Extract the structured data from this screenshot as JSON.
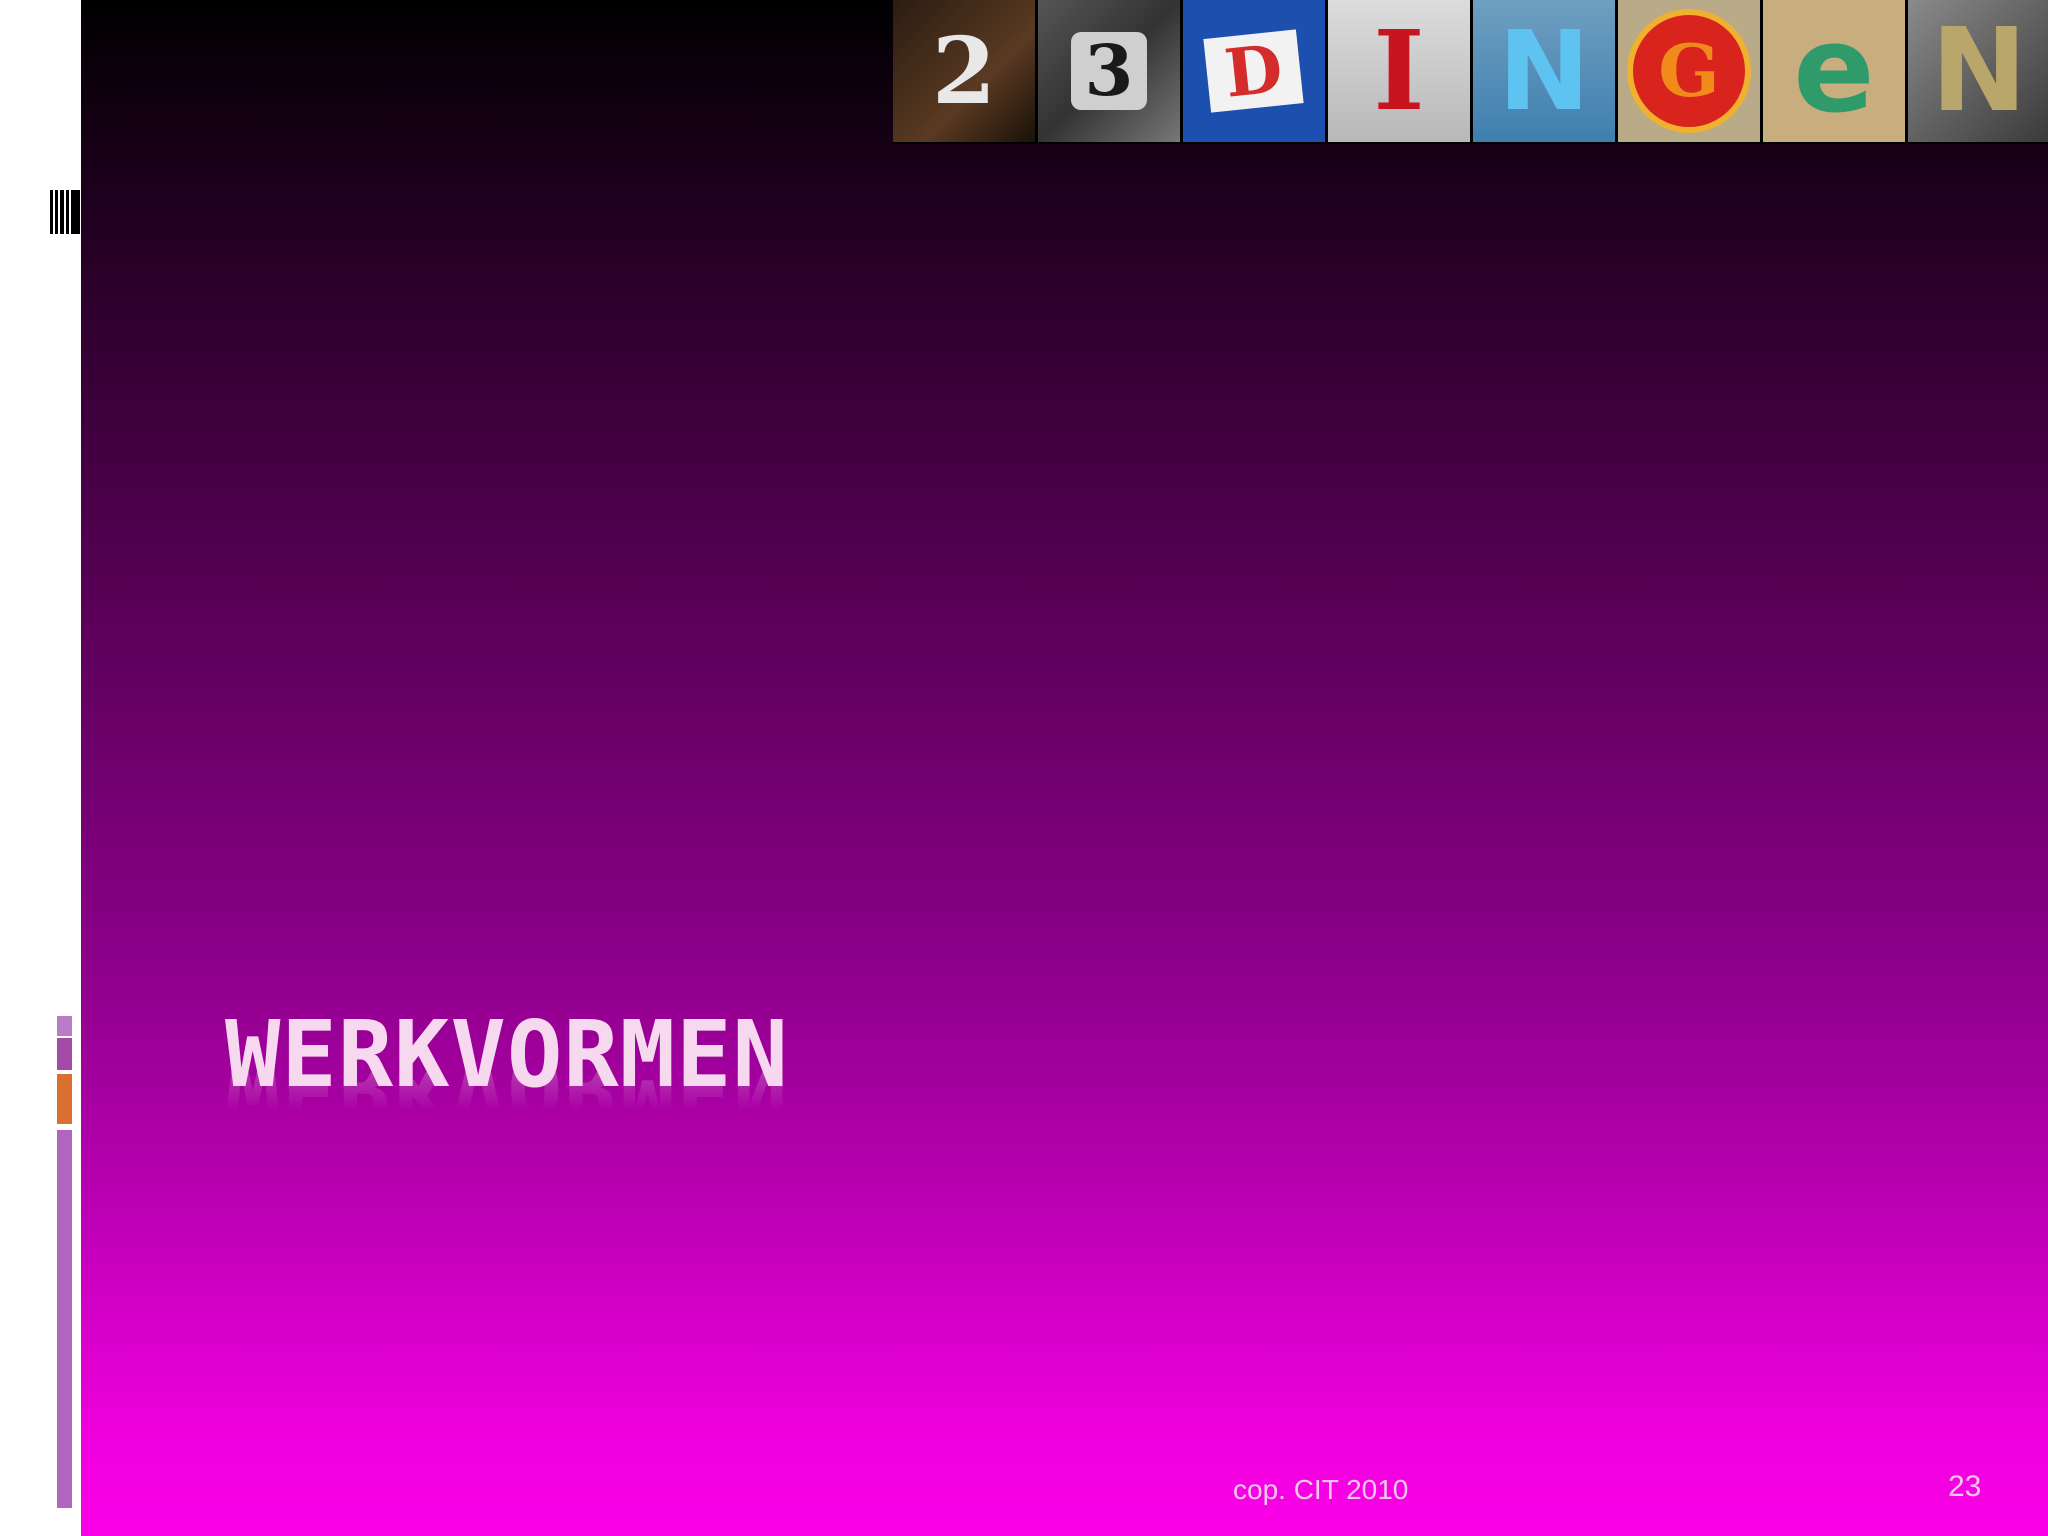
{
  "slide": {
    "title": "WERKVORMEN",
    "footer": "cop. CIT 2010",
    "page_number": "23"
  },
  "logo_strip": {
    "letters": [
      "2",
      "3",
      "D",
      "I",
      "N",
      "G",
      "e",
      "N"
    ]
  },
  "colors": {
    "title": "#f6d8ef",
    "gradient_top": "#000000",
    "gradient_bottom": "#fa00e8",
    "accent_orange": "#d9702f",
    "accent_purple": "#b066c0",
    "accent_magenta": "#a64aa8"
  }
}
